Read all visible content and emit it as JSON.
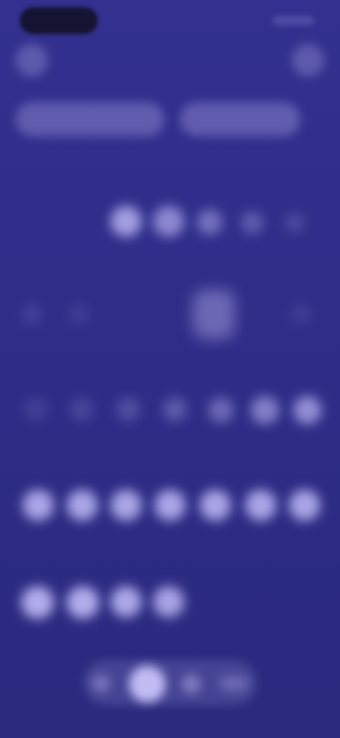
{
  "screen": {
    "colors": {
      "background_top": "#33308f",
      "background_bottom": "#2b2a7e",
      "accent": "#c9c4ff",
      "status_pill": "#141432"
    },
    "status_bar": {
      "time": "",
      "indicators": ""
    },
    "header": {
      "left_icon": "menu-icon",
      "right_icon": "profile-icon"
    },
    "tabs": [
      {
        "label": ""
      },
      {
        "label": ""
      }
    ],
    "content": {
      "rows_of_dots": 6,
      "note": ""
    },
    "bottom_nav": {
      "items": [
        "home-icon",
        "active-item-icon",
        "search-icon",
        "settings-icon"
      ]
    }
  }
}
